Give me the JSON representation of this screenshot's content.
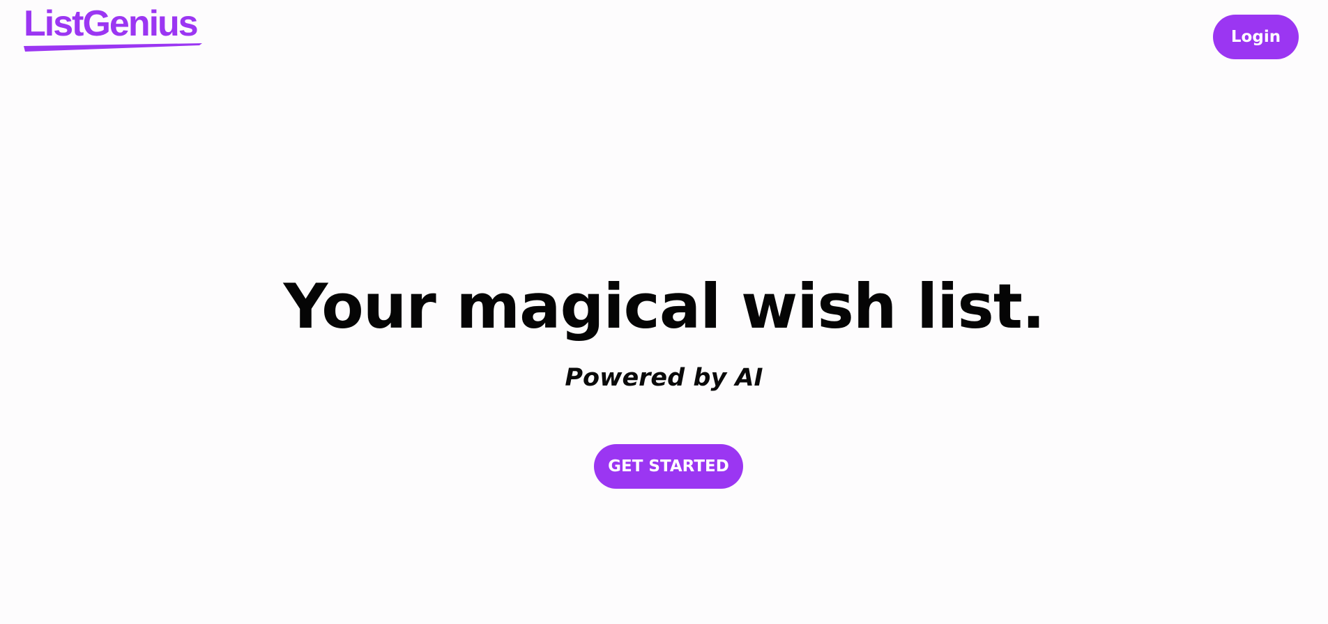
{
  "header": {
    "logo_text": "ListGenius",
    "login_label": "Login"
  },
  "hero": {
    "headline": "Your magical wish list.",
    "subheadline": "Powered by AI",
    "cta_label": "GET STARTED"
  },
  "colors": {
    "brand_purple": "#9b36f2",
    "background": "#fdfcfd",
    "text": "#050505",
    "button_text": "#ffffff"
  }
}
